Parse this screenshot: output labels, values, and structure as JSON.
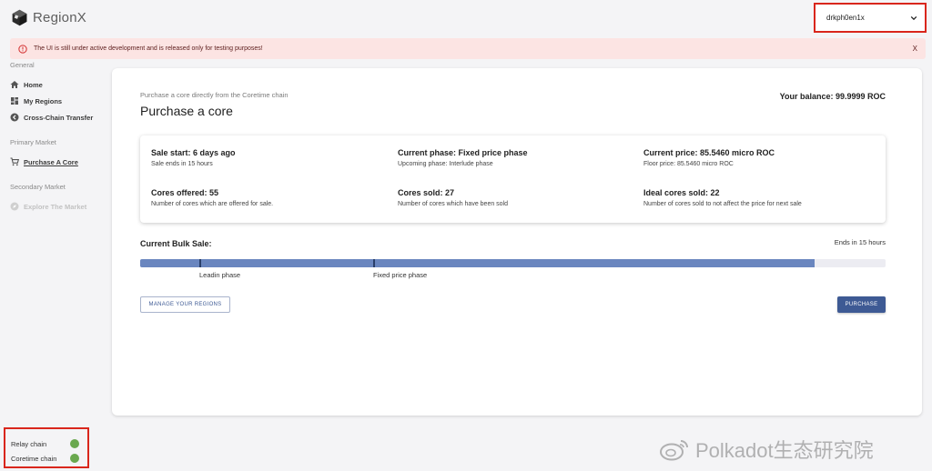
{
  "app": {
    "name": "RegionX"
  },
  "account": {
    "selected": "drkph0en1x"
  },
  "alert": {
    "message": "The UI is still under active development and is released only for testing purposes!",
    "close_label": "X"
  },
  "sidebar": {
    "general_title": "General",
    "general_items": [
      {
        "label": "Home",
        "icon": "home-icon"
      },
      {
        "label": "My Regions",
        "icon": "dashboard-icon"
      },
      {
        "label": "Cross-Chain Transfer",
        "icon": "transfer-icon"
      }
    ],
    "primary_title": "Primary Market",
    "primary_items": [
      {
        "label": "Purchase A Core",
        "icon": "cart-icon",
        "active": true
      }
    ],
    "secondary_title": "Secondary Market",
    "secondary_items": [
      {
        "label": "Explore The Market",
        "icon": "explore-icon",
        "disabled": true
      }
    ]
  },
  "main": {
    "subtitle": "Purchase a core directly from the Coretime chain",
    "title": "Purchase a core",
    "balance": "Your balance: 99.9999 ROC",
    "info": {
      "sale_start": "Sale start: 6 days ago",
      "sale_ends": "Sale ends in 15 hours",
      "current_phase": "Current phase: Fixed price phase",
      "upcoming_phase": "Upcoming phase: Interlude phase",
      "current_price": "Current price: 85.5460 micro ROC",
      "floor_price": "Floor price: 85.5460 micro ROC",
      "cores_offered": "Cores offered: 55",
      "cores_offered_desc": "Number of cores which are offered for sale.",
      "cores_sold": "Cores sold: 27",
      "cores_sold_desc": "Number of cores which have been sold",
      "ideal_cores": "Ideal cores sold: 22",
      "ideal_cores_desc": "Number of cores sold to not affect the price for next sale"
    },
    "bulk_sale": {
      "title": "Current Bulk Sale:",
      "ends": "Ends in 15 hours",
      "progress": 0.905,
      "phases": [
        "Leadin phase",
        "Fixed price phase"
      ]
    },
    "buttons": {
      "manage": "MANAGE YOUR REGIONS",
      "purchase": "PURCHASE"
    }
  },
  "chains": [
    {
      "name": "Relay chain",
      "status_color": "#6aa84f"
    },
    {
      "name": "Coretime chain",
      "status_color": "#6aa84f"
    }
  ],
  "watermark": {
    "text": "Polkadot生态研究院"
  },
  "colors": {
    "accent": "#3e5a94",
    "progress": "#6a86bf",
    "alert_bg": "#fce4e3",
    "highlight_border": "#d9261c"
  }
}
